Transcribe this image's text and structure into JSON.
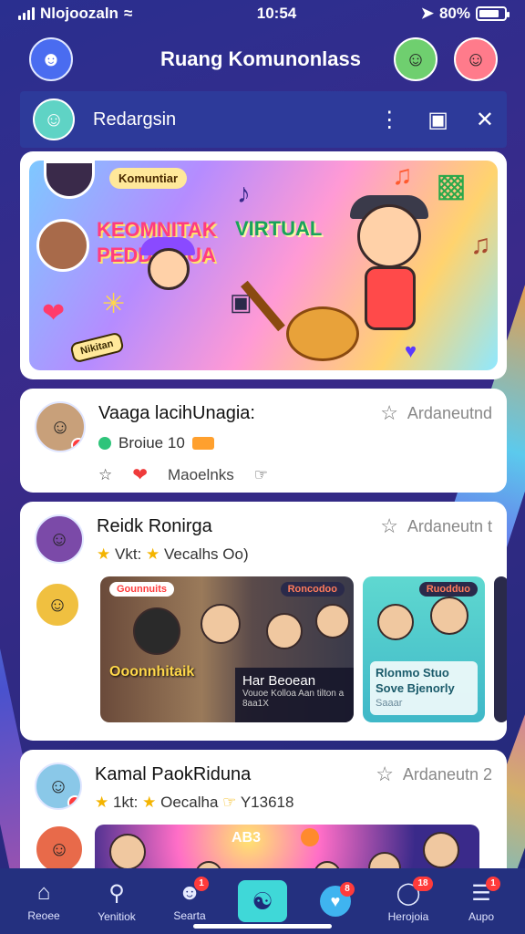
{
  "status": {
    "carrier": "Nlojoozaln",
    "time": "10:54",
    "battery": "80%",
    "battery_level": 0.8
  },
  "header": {
    "title": "Ruang Komunonlass"
  },
  "subbar": {
    "title": "Redargsin"
  },
  "banner": {
    "chip": "Komuntiar",
    "headline_line1": "KEOMNITAK",
    "headline_line2": "PEDDRNIUA",
    "headline_right": "VIRTUAL",
    "sticker": "Nikitan"
  },
  "posts": [
    {
      "title": "Vaaga lacihUnagia:",
      "meta": "Ardaneutnd",
      "sub_text": "Broiue 10",
      "action_like": "Maoelnks"
    },
    {
      "title": "Reidk Ronirga",
      "meta": "Ardaneutn t",
      "stars_text_1": "Vkt:",
      "stars_text_2": "Vecalhs Oo)",
      "tile_a_tag_left": "Gounnuits",
      "tile_a_tag_right": "Roncodoo",
      "tile_a_caption": "Ooonnhitaik",
      "tile_a_panel_title": "Har Beoean",
      "tile_a_panel_small": "Vouoe Kolloa Aan tilton a",
      "tile_a_panel_sub": "8aa1X",
      "tile_b_tag": "Ruodduo",
      "tile_b_title": "Rlonmo Stuo",
      "tile_b_sub": "Sove Bjenorly",
      "tile_b_small": "Saaar"
    },
    {
      "title": "Kamal PaokRiduna",
      "meta": "Ardaneutn 2",
      "stars_text_1": "1kt:",
      "stars_text_2": "Oecalha",
      "stars_text_3": "Y13618",
      "media_tag": "AB3"
    }
  ],
  "nav": [
    {
      "label": "Reoee",
      "icon": "home-icon"
    },
    {
      "label": "Yenitiok",
      "icon": "search-icon"
    },
    {
      "label": "Searta",
      "icon": "profile-icon",
      "badge": "1"
    },
    {
      "label": "",
      "icon": "community-icon"
    },
    {
      "label": "",
      "icon": "heart-icon",
      "badge": "8"
    },
    {
      "label": "Herojoia",
      "icon": "chat-icon",
      "badge": "18"
    },
    {
      "label": "Aupo",
      "icon": "inbox-icon",
      "badge": "1"
    }
  ]
}
